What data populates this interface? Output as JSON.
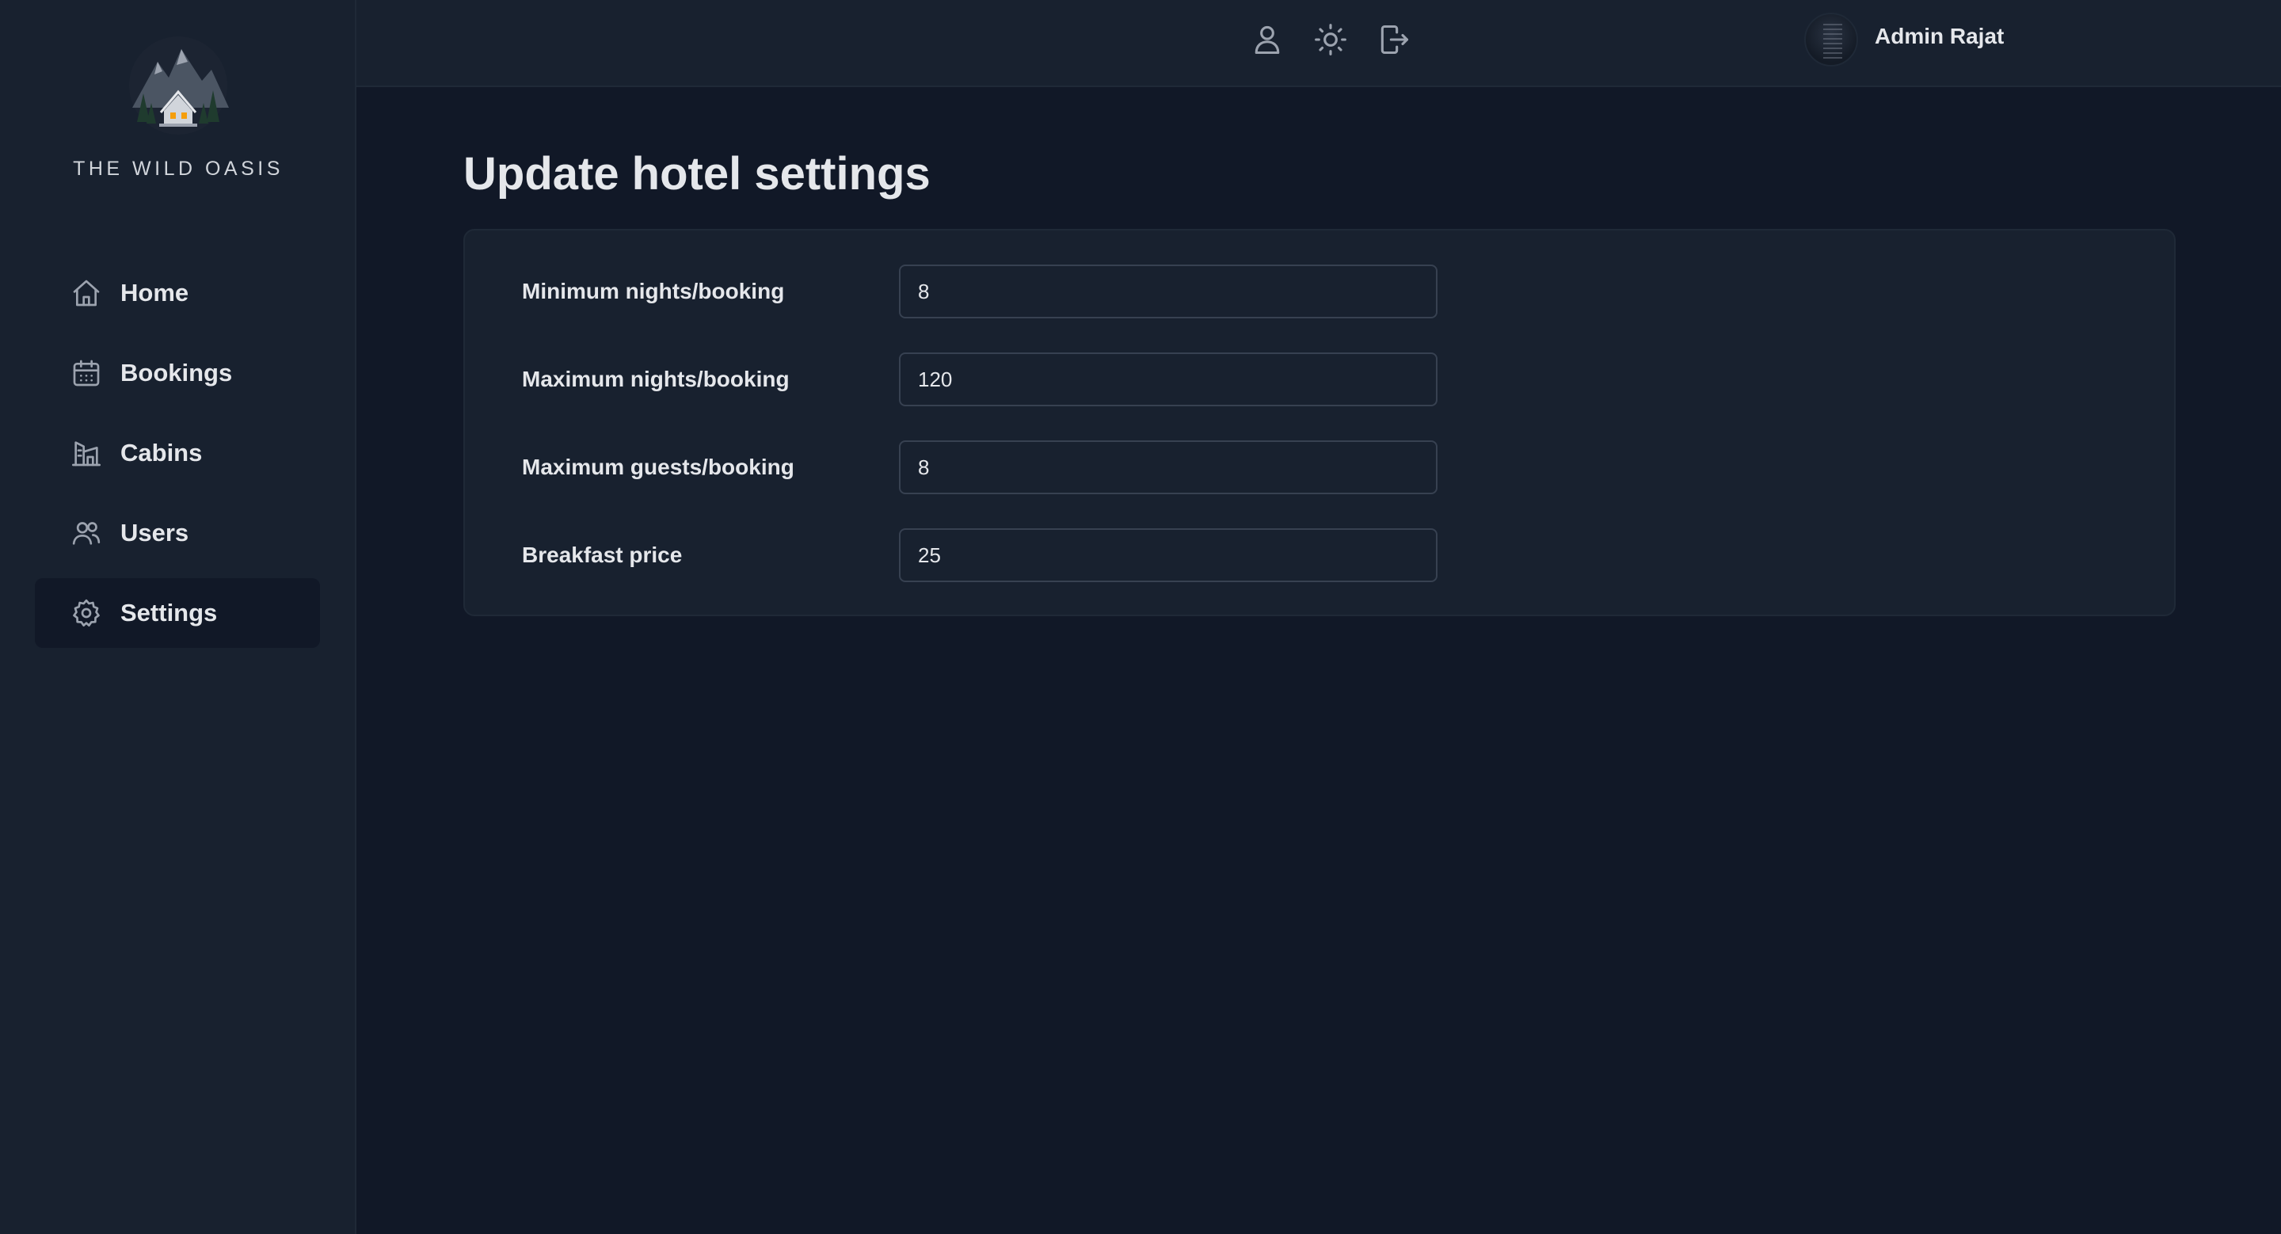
{
  "brand": {
    "name": "THE WILD OASIS",
    "logo_icon": "cabin-mountain-logo-icon"
  },
  "sidebar": {
    "items": [
      {
        "label": "Home",
        "icon": "home-icon",
        "active": false
      },
      {
        "label": "Bookings",
        "icon": "calendar-icon",
        "active": false
      },
      {
        "label": "Cabins",
        "icon": "building-icon",
        "active": false
      },
      {
        "label": "Users",
        "icon": "users-icon",
        "active": false
      },
      {
        "label": "Settings",
        "icon": "gear-icon",
        "active": true
      }
    ]
  },
  "header": {
    "user_name": "Admin Rajat",
    "actions": [
      {
        "name": "account",
        "icon": "user-icon"
      },
      {
        "name": "theme",
        "icon": "sun-icon"
      },
      {
        "name": "logout",
        "icon": "logout-icon"
      }
    ]
  },
  "main": {
    "title": "Update hotel settings",
    "form": {
      "fields": [
        {
          "label": "Minimum nights/booking",
          "value": "8"
        },
        {
          "label": "Maximum nights/booking",
          "value": "120"
        },
        {
          "label": "Maximum guests/booking",
          "value": "8"
        },
        {
          "label": "Breakfast price",
          "value": "25"
        }
      ]
    }
  },
  "colors": {
    "background": "#111827",
    "panel": "#18212f",
    "border": "#1f2937",
    "input_border": "#374151",
    "text": "#e5e7eb",
    "icon": "#9ca3af"
  }
}
